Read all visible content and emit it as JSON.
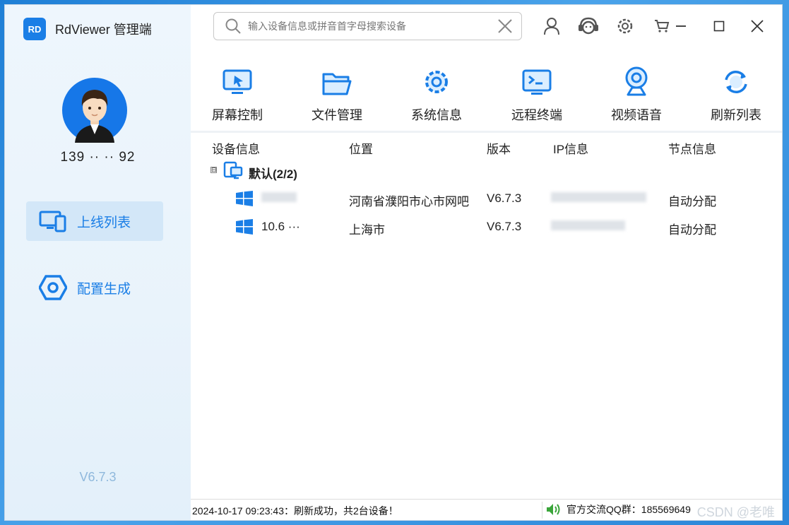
{
  "app": {
    "logo_text": "RD",
    "title": "RdViewer 管理端"
  },
  "user": {
    "phone": "139 ·· ·· 92"
  },
  "sidebar": {
    "items": [
      {
        "label": "上线列表",
        "icon": "monitor-devices-icon",
        "active": true
      },
      {
        "label": "配置生成",
        "icon": "hexagon-settings-icon",
        "active": false
      }
    ],
    "version": "V6.7.3"
  },
  "search": {
    "placeholder": "输入设备信息或拼音首字母搜索设备",
    "value": ""
  },
  "toolbar": {
    "items": [
      {
        "label": "屏幕控制",
        "icon": "screen-control-icon"
      },
      {
        "label": "文件管理",
        "icon": "folder-icon"
      },
      {
        "label": "系统信息",
        "icon": "gear-icon"
      },
      {
        "label": "远程终端",
        "icon": "terminal-icon"
      },
      {
        "label": "视频语音",
        "icon": "webcam-icon"
      },
      {
        "label": "刷新列表",
        "icon": "refresh-icon"
      }
    ]
  },
  "table": {
    "columns": [
      "设备信息",
      "位置",
      "版本",
      "IP信息",
      "节点信息"
    ],
    "group": {
      "label": "默认(2/2)",
      "expand_symbol": "⊟"
    },
    "rows": [
      {
        "device": "··",
        "location": "河南省濮阳市心市网吧",
        "version": "V6.7.3",
        "ip": "··",
        "node": "自动分配"
      },
      {
        "device": "10.6 ···",
        "location": "上海市",
        "version": "V6.7.3",
        "ip": "··",
        "node": "自动分配"
      }
    ]
  },
  "status": {
    "message": "2024-10-17 09:23:43：刷新成功，共2台设备！",
    "qq": "官方交流QQ群：185569649",
    "watermark": "CSDN @老唯"
  },
  "colors": {
    "accent": "#1a7ee6",
    "sidebar_bg": "#eaf4fc",
    "active_item_bg": "#d3e7f8"
  }
}
